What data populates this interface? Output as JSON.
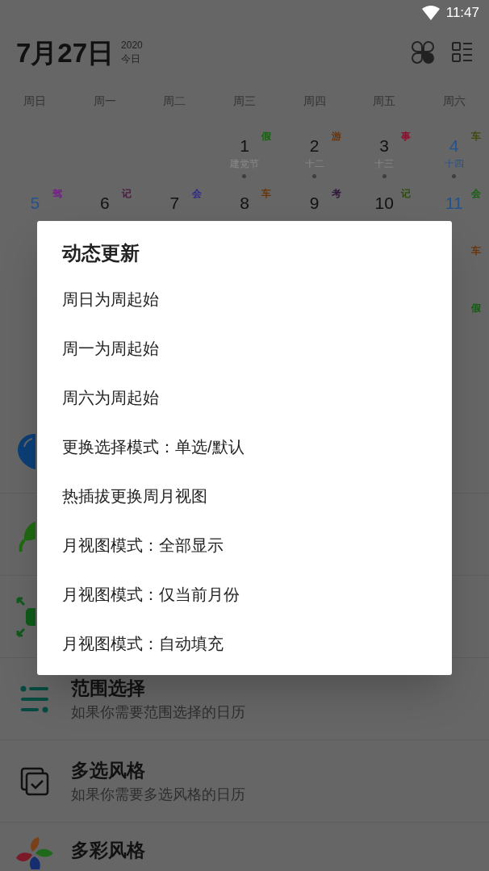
{
  "status_bar": {
    "time": "11:47"
  },
  "header": {
    "date": "7月27日",
    "year": "2020",
    "today": "今日"
  },
  "weekdays": [
    "周日",
    "周一",
    "周二",
    "周三",
    "周四",
    "周五",
    "周六"
  ],
  "weeks": [
    {
      "days": [
        {
          "kind": "blank"
        },
        {
          "kind": "blank"
        },
        {
          "kind": "blank"
        },
        {
          "kind": "day",
          "day": "1",
          "lunar": "建党节",
          "weekend": false,
          "lunar_highlight": false,
          "mark": "假",
          "color": "#15600f",
          "dot": true
        },
        {
          "kind": "day",
          "day": "2",
          "lunar": "十二",
          "weekend": false,
          "lunar_highlight": false,
          "mark": "游",
          "color": "#6a3408",
          "dot": true
        },
        {
          "kind": "day",
          "day": "3",
          "lunar": "十三",
          "weekend": false,
          "lunar_highlight": false,
          "mark": "事",
          "color": "#8a1030",
          "dot": true
        },
        {
          "kind": "day",
          "day": "4",
          "lunar": "十四",
          "weekend": true,
          "lunar_highlight": true,
          "mark": "车",
          "color": "#3e4a08",
          "dot": true
        }
      ]
    },
    {
      "days": [
        {
          "kind": "day",
          "day": "5",
          "weekend": true,
          "mark": "驾",
          "color": "#7a1890"
        },
        {
          "kind": "day",
          "day": "6",
          "weekend": false,
          "mark": "记",
          "color": "#4a1a40"
        },
        {
          "kind": "day",
          "day": "7",
          "weekend": false,
          "mark": "会",
          "color": "#2e2a8a"
        },
        {
          "kind": "day",
          "day": "8",
          "weekend": false,
          "mark": "车",
          "color": "#6a3406"
        },
        {
          "kind": "day",
          "day": "9",
          "weekend": false,
          "mark": "考",
          "color": "#301838"
        },
        {
          "kind": "day",
          "day": "10",
          "weekend": false,
          "mark": "记",
          "color": "#2a4e0a"
        },
        {
          "kind": "day",
          "day": "11",
          "weekend": true,
          "mark": "会",
          "color": "#15600e"
        }
      ]
    },
    {
      "days": [
        {
          "kind": "blank"
        },
        {
          "kind": "blank"
        },
        {
          "kind": "blank"
        },
        {
          "kind": "blank"
        },
        {
          "kind": "blank"
        },
        {
          "kind": "blank"
        },
        {
          "kind": "covered",
          "mark": "车",
          "color": "#6a3408"
        }
      ]
    },
    {
      "days": [
        {
          "kind": "blank"
        },
        {
          "kind": "blank"
        },
        {
          "kind": "blank"
        },
        {
          "kind": "blank"
        },
        {
          "kind": "blank"
        },
        {
          "kind": "blank"
        },
        {
          "kind": "covered",
          "mark": "假",
          "color": "#125a12"
        }
      ]
    }
  ],
  "list": [
    {
      "kind": "balloon"
    },
    {
      "kind": "leaf"
    },
    {
      "kind": "expand"
    },
    {
      "kind": "range",
      "title": "范围选择",
      "subtitle": "如果你需要范围选择的日历"
    },
    {
      "kind": "multi",
      "title": "多选风格",
      "subtitle": "如果你需要多选风格的日历"
    },
    {
      "kind": "colorful",
      "title": "多彩风格"
    }
  ],
  "dialog": {
    "title": "动态更新",
    "options": [
      "周日为周起始",
      "周一为周起始",
      "周六为周起始",
      "更换选择模式：单选/默认",
      "热插拔更换周月视图",
      "月视图模式：全部显示",
      "月视图模式：仅当前月份",
      "月视图模式：自动填充"
    ]
  }
}
